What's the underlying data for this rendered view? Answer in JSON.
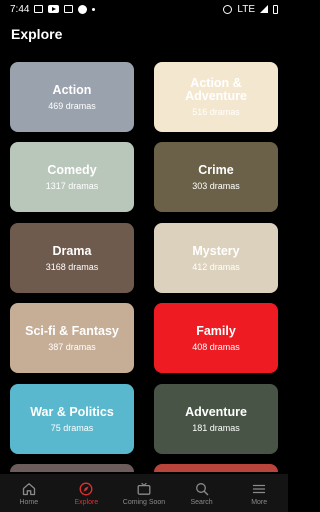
{
  "status": {
    "time": "7:44",
    "network": "LTE"
  },
  "header": {
    "title": "Explore"
  },
  "categories": [
    {
      "name": "Action",
      "count": "469 dramas",
      "color": "#9aa2ad",
      "text_color": "#ffffff"
    },
    {
      "name": "Action & Adventure",
      "count": "516 dramas",
      "color": "#f4e7cf",
      "text_color": "#ffffff"
    },
    {
      "name": "Comedy",
      "count": "1317 dramas",
      "color": "#b9c7bb",
      "text_color": "#ffffff"
    },
    {
      "name": "Crime",
      "count": "303 dramas",
      "color": "#6b6148",
      "text_color": "#ffffff"
    },
    {
      "name": "Drama",
      "count": "3168 dramas",
      "color": "#6f5a4e",
      "text_color": "#ffffff"
    },
    {
      "name": "Mystery",
      "count": "412 dramas",
      "color": "#dcd1bd",
      "text_color": "#ffffff"
    },
    {
      "name": "Sci-fi & Fantasy",
      "count": "387 dramas",
      "color": "#c6ad96",
      "text_color": "#ffffff"
    },
    {
      "name": "Family",
      "count": "408 dramas",
      "color": "#ee1b22",
      "text_color": "#ffffff"
    },
    {
      "name": "War & Politics",
      "count": "75 dramas",
      "color": "#59b8cd",
      "text_color": "#ffffff"
    },
    {
      "name": "Adventure",
      "count": "181 dramas",
      "color": "#485546",
      "text_color": "#ffffff"
    },
    {
      "name": "",
      "count": "",
      "color": "#6c5c5c",
      "text_color": "#ffffff"
    },
    {
      "name": "",
      "count": "",
      "color": "#b8443c",
      "text_color": "#ffffff"
    }
  ],
  "nav": {
    "items": [
      {
        "label": "Home",
        "icon": "home-icon"
      },
      {
        "label": "Explore",
        "icon": "compass-icon"
      },
      {
        "label": "Coming Soon",
        "icon": "tv-icon"
      },
      {
        "label": "Search",
        "icon": "search-icon"
      },
      {
        "label": "More",
        "icon": "menu-icon"
      }
    ],
    "active_color": "#e0312e",
    "inactive_color": "#8a8a8a"
  }
}
